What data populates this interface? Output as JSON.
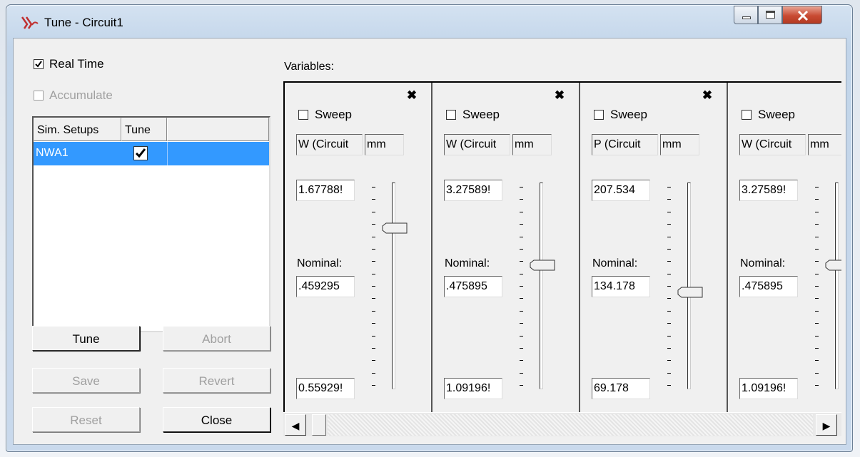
{
  "window": {
    "title": "Tune - Circuit1"
  },
  "options": {
    "real_time": {
      "label": "Real Time",
      "checked": true
    },
    "accumulate": {
      "label": "Accumulate",
      "checked": false,
      "enabled": false
    }
  },
  "sim_setups": {
    "columns": [
      "Sim. Setups",
      "Tune"
    ],
    "rows": [
      {
        "name": "NWA1",
        "tune": true
      }
    ]
  },
  "buttons": {
    "tune": "Tune",
    "abort": "Abort",
    "save": "Save",
    "revert": "Revert",
    "reset": "Reset",
    "close": "Close"
  },
  "variables_label": "Variables:",
  "variables": [
    {
      "sweep_label": "Sweep",
      "name": "W (Circuit",
      "unit": "mm",
      "max": "1.67788!",
      "nominal_label": "Nominal:",
      "nominal": ".459295",
      "min": "0.55929!",
      "slider_level": 0.78
    },
    {
      "sweep_label": "Sweep",
      "name": "W (Circuit",
      "unit": "mm",
      "max": "3.27589!",
      "nominal_label": "Nominal:",
      "nominal": ".475895",
      "min": "1.09196!",
      "slider_level": 0.6
    },
    {
      "sweep_label": "Sweep",
      "name": "P (Circuit",
      "unit": "mm",
      "max": "207.534",
      "nominal_label": "Nominal:",
      "nominal": "134.178",
      "min": "69.178",
      "slider_level": 0.47
    },
    {
      "sweep_label": "Sweep",
      "name": "W (Circuit",
      "unit": "mm",
      "max": "3.27589!",
      "nominal_label": "Nominal:",
      "nominal": ".475895",
      "min": "1.09196!",
      "slider_level": 0.6
    }
  ]
}
